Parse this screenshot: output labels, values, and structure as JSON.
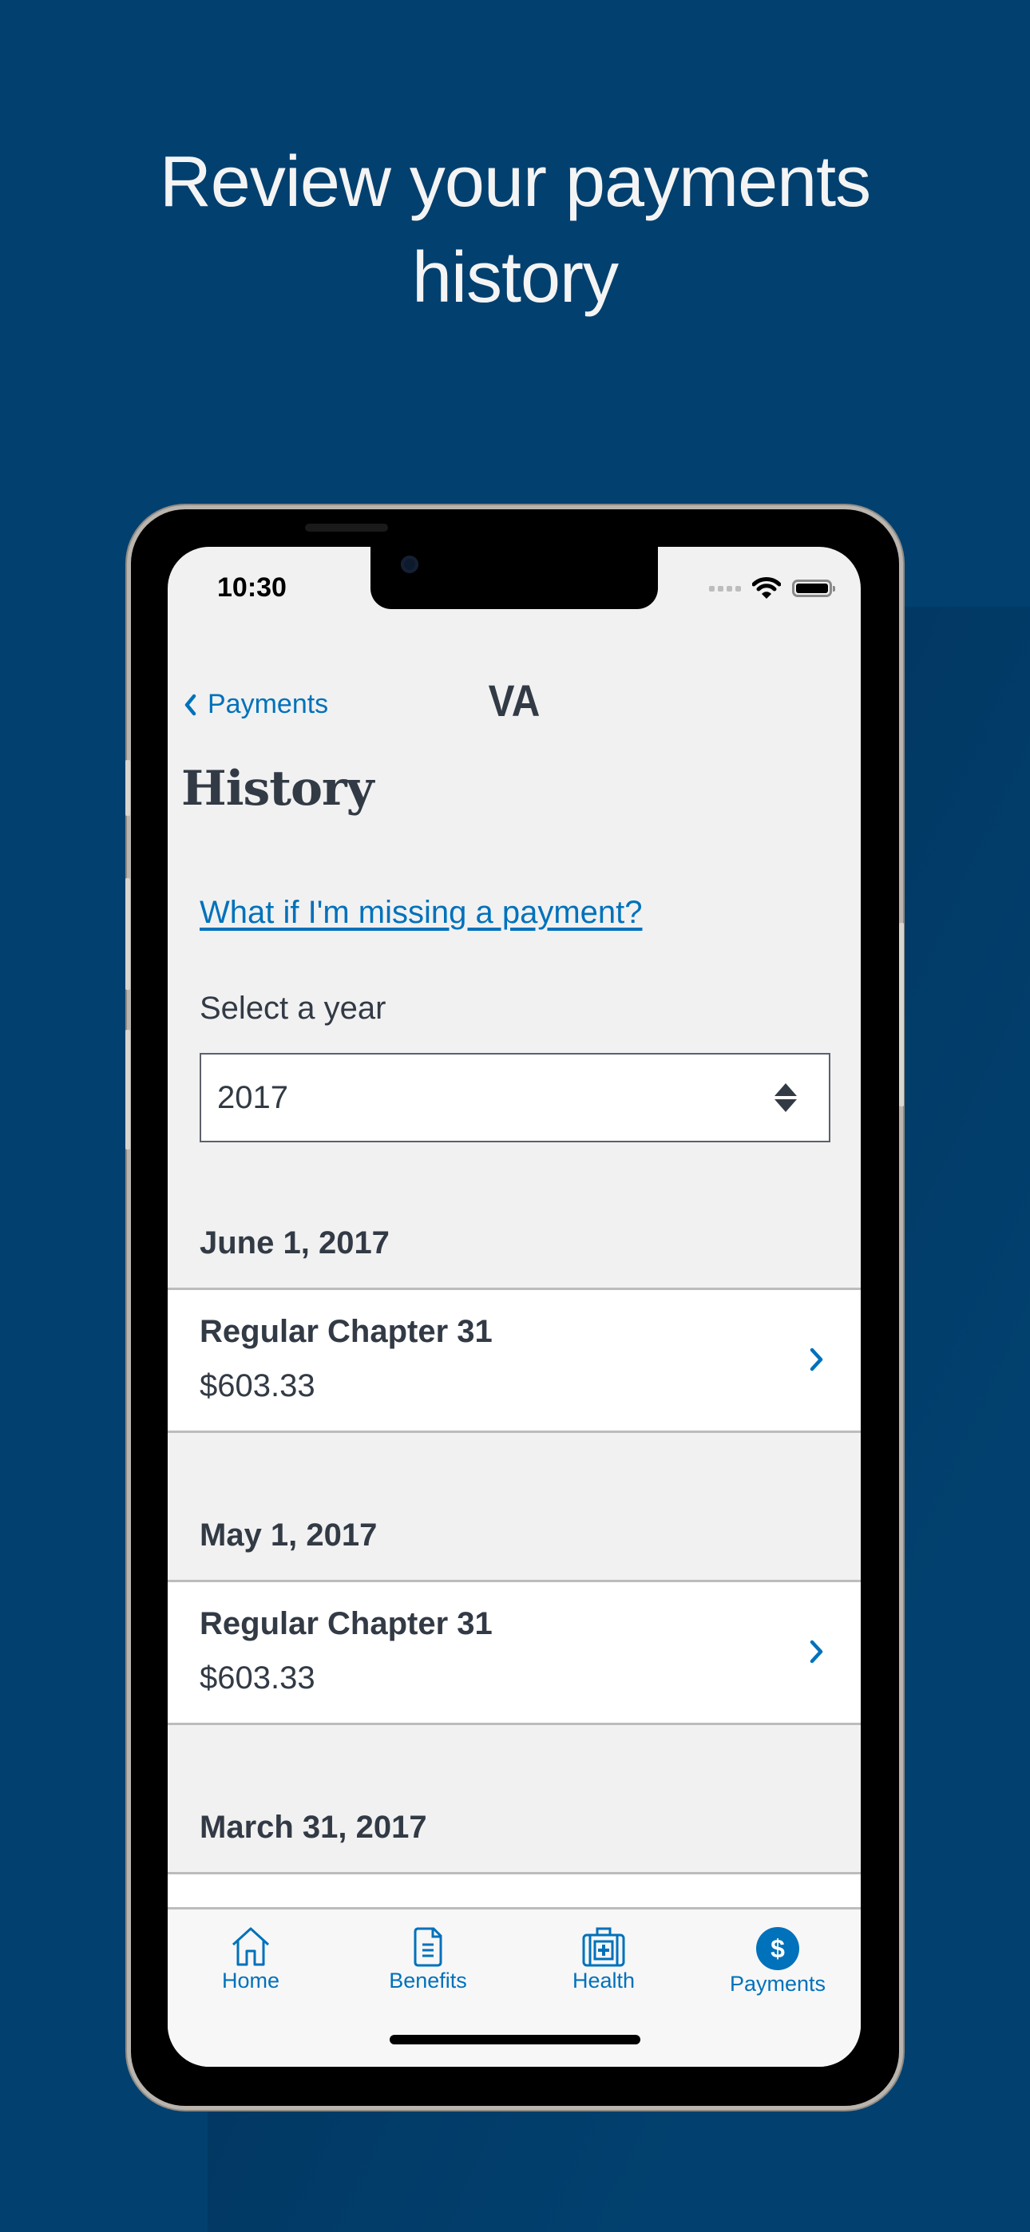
{
  "headline": {
    "line1": "Review your payments",
    "line2": "history"
  },
  "colors": {
    "background": "#02406f",
    "accent": "#0071bb",
    "text": "#323a45",
    "screen_bg": "#f1f1f1"
  },
  "status_bar": {
    "time": "10:30",
    "icons": [
      "signal-dots-icon",
      "wifi-icon",
      "battery-icon"
    ]
  },
  "nav": {
    "back_label": "Payments",
    "title": "VA"
  },
  "page": {
    "title": "History",
    "help_link": "What if I'm missing a payment?",
    "select_label": "Select a year",
    "selected_year": "2017"
  },
  "payments": [
    {
      "date": "June 1, 2017",
      "title": "Regular Chapter 31",
      "amount": "$603.33"
    },
    {
      "date": "May 1, 2017",
      "title": "Regular Chapter 31",
      "amount": "$603.33"
    },
    {
      "date": "March 31, 2017",
      "title": "",
      "amount": ""
    }
  ],
  "tabbar": {
    "items": [
      {
        "label": "Home",
        "icon": "home-icon",
        "active": false
      },
      {
        "label": "Benefits",
        "icon": "document-icon",
        "active": false
      },
      {
        "label": "Health",
        "icon": "medical-kit-icon",
        "active": false
      },
      {
        "label": "Payments",
        "icon": "dollar-circle-icon",
        "active": true
      }
    ]
  }
}
